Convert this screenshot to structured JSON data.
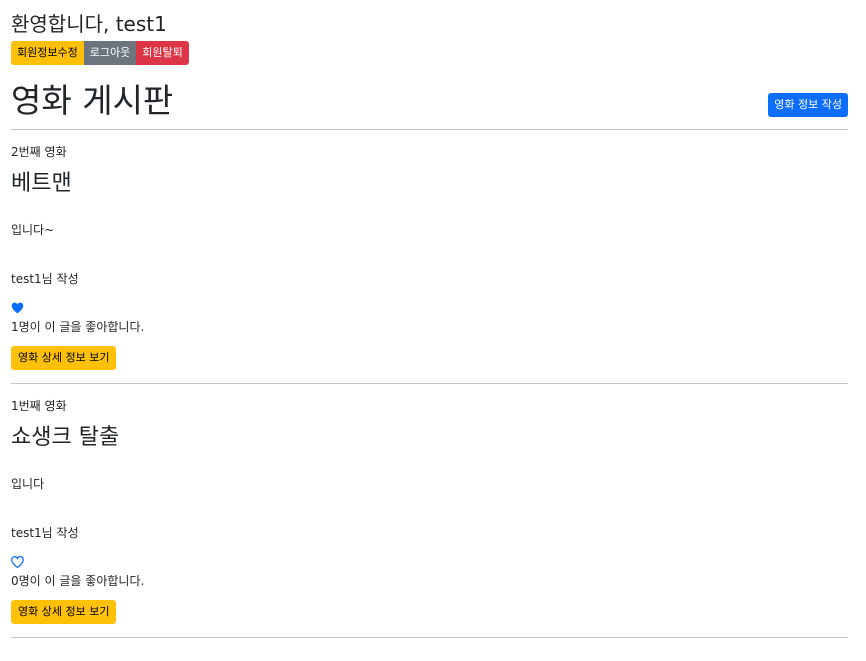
{
  "header": {
    "welcome": "환영합니다, test1",
    "buttons": {
      "edit_profile": "회원정보수정",
      "logout": "로그아웃",
      "withdraw": "회원탈퇴"
    }
  },
  "board": {
    "title": "영화 게시판",
    "write_button": "영화 정보 작성"
  },
  "posts": [
    {
      "seq": "2번째 영화",
      "title": "베트맨",
      "content": "입니다~",
      "author": "test1님 작성",
      "liked": true,
      "likes": "1명이 이 글을 좋아합니다.",
      "detail_button": "영화 상세 정보 보기"
    },
    {
      "seq": "1번째 영화",
      "title": "쇼생크 탈출",
      "content": "입니다",
      "author": "test1님 작성",
      "liked": false,
      "likes": "0명이 이 글을 좋아합니다.",
      "detail_button": "영화 상세 정보 보기"
    }
  ],
  "colors": {
    "warning": "#ffc107",
    "secondary": "#6c757d",
    "danger": "#dc3545",
    "primary": "#0d6efd",
    "heart": "#0d6efd"
  },
  "icons": {
    "liked": "heart-filled-icon",
    "not_liked": "heart-outline-icon"
  }
}
